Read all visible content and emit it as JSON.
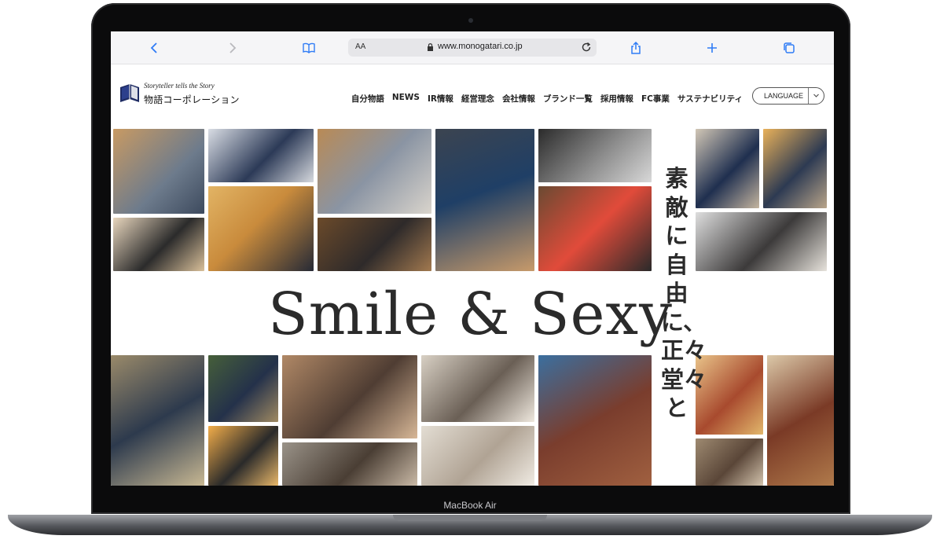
{
  "device": {
    "label": "MacBook Air"
  },
  "browser": {
    "text_size_button": "AA",
    "url": "www.monogatari.co.jp",
    "icons": [
      "back-icon",
      "forward-icon",
      "bookmarks-icon",
      "lock-icon",
      "reload-icon",
      "share-icon",
      "new-tab-icon",
      "tabs-icon"
    ]
  },
  "site": {
    "logo": {
      "tagline": "Storyteller tells the Story",
      "name": "物語コーポレーション"
    },
    "nav": [
      "自分物語",
      "NEWS",
      "IR情報",
      "経営理念",
      "会社情報",
      "ブランド一覧",
      "採用情報",
      "FC事業",
      "サステナビリティ"
    ],
    "language_button": "LANGUAGE"
  },
  "hero": {
    "title": "Smile & Sexy",
    "vertical_copy": "素敵に自由に、正々堂々と"
  },
  "colors": {
    "accent_blue": "#2f7cf6",
    "logo_navy": "#1e2b63",
    "text_dark": "#2b2b2b"
  }
}
